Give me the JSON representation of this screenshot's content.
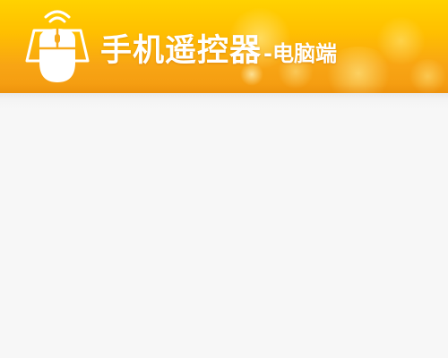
{
  "header": {
    "title_main": "手机遥控器",
    "title_sub": "-电脑端",
    "logo_icon": "wireless-mouse-icon",
    "colors": {
      "gradient_top": "#ffd200",
      "gradient_bottom": "#f39a10",
      "text": "#ffffff"
    }
  },
  "content": {
    "background": "#f7f7f7"
  }
}
